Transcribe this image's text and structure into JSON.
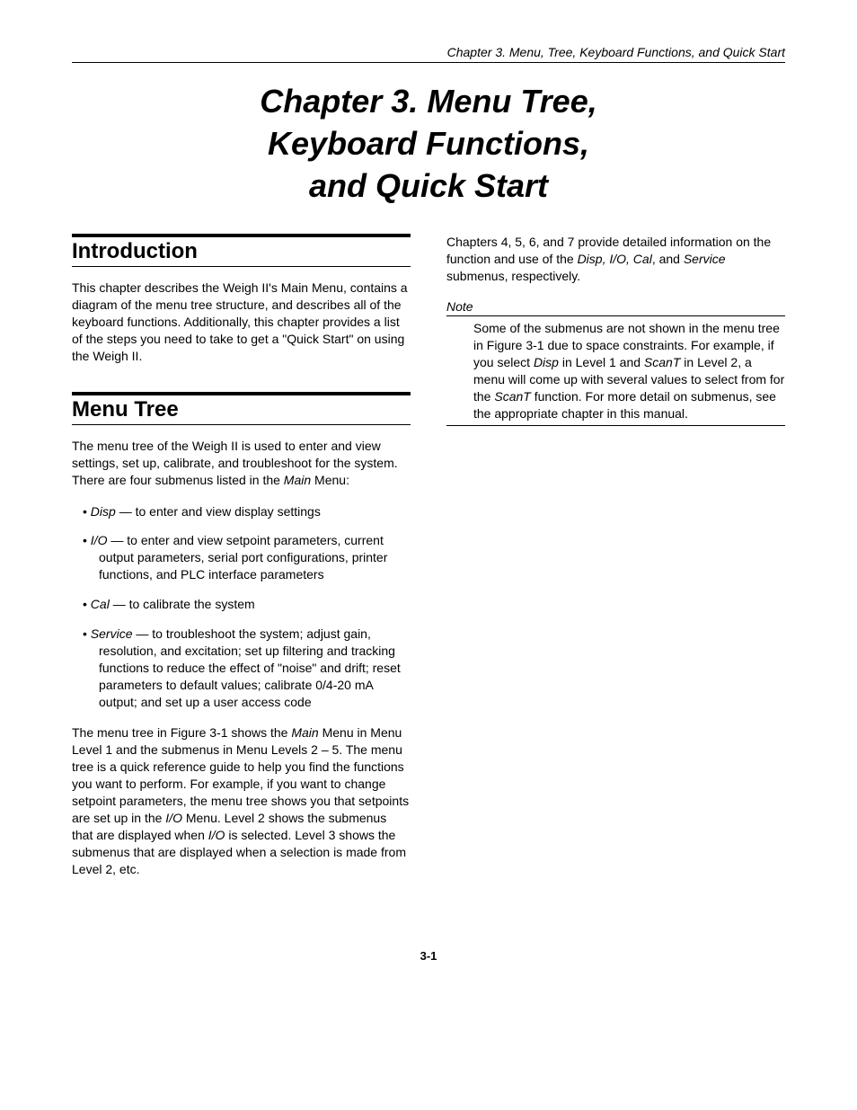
{
  "running_header": "Chapter 3. Menu, Tree, Keyboard Functions, and Quick Start",
  "chapter_title_line1": "Chapter 3. Menu Tree,",
  "chapter_title_line2": "Keyboard Functions,",
  "chapter_title_line3": "and Quick Start",
  "sections": {
    "introduction": {
      "heading": "Introduction",
      "body": "This chapter describes the Weigh II's Main Menu, contains a diagram of the menu tree structure, and describes all of the keyboard functions. Additionally, this chapter provides a list of the steps you need to take to get a \"Quick Start\" on using the Weigh II."
    },
    "menu_tree": {
      "heading": "Menu Tree",
      "intro_prefix": "The menu tree of the Weigh II is used to enter and view settings, set up, calibrate, and troubleshoot for the system. There are four submenus listed in the ",
      "intro_main_word": "Main",
      "intro_suffix": " Menu:",
      "items": [
        {
          "name": "Disp",
          "desc": " — to enter and view display settings"
        },
        {
          "name": "I/O",
          "desc": " — to enter and view setpoint parameters, current output parameters, serial port configurations, printer functions, and PLC interface parameters"
        },
        {
          "name": "Cal",
          "desc": " — to calibrate the system"
        },
        {
          "name": "Service",
          "desc": " — to troubleshoot the system; adjust gain, resolution, and excitation; set up filtering and tracking functions to reduce the effect of \"noise\" and drift; reset parameters to default values; calibrate 0/4-20 mA output; and set up a user access code"
        }
      ],
      "figure_para_prefix": "The menu tree in Figure 3-1 shows the ",
      "figure_para_main": "Main",
      "figure_para_mid1": " Menu in Menu Level 1 and the submenus in Menu Levels 2 – 5. The menu tree is a quick reference guide to help you find the functions you want to perform. For example, if you want to change setpoint parameters, the menu tree shows you that setpoints are set up in the ",
      "figure_para_io": "I/O",
      "figure_para_mid2": " Menu. Level 2 shows the submenus that are displayed when ",
      "figure_para_io2": "I/O",
      "figure_para_suffix": " is selected. Level 3 shows the submenus that are displayed when a selection is made from Level 2, etc."
    }
  },
  "col2": {
    "chapters_para_prefix": "Chapters 4, 5, 6, and 7 provide detailed information on the function and use of the ",
    "chapters_para_italic": "Disp, I/O, Cal",
    "chapters_para_mid": ", and ",
    "chapters_para_italic2": "Service",
    "chapters_para_suffix": " submenus, respectively.",
    "note_label": "Note",
    "note_p1": "Some of the submenus are not shown in the menu tree in Figure 3-1 due to space constraints. For example, if you select ",
    "note_disp": "Disp",
    "note_p2": " in Level 1 and ",
    "note_scant": "ScanT",
    "note_p3": " in Level 2, a menu will come up with several values to select from for the ",
    "note_scant2": "ScanT",
    "note_p4": " function. For more detail on submenus, see the appropriate chapter in this manual."
  },
  "page_number": "3-1"
}
